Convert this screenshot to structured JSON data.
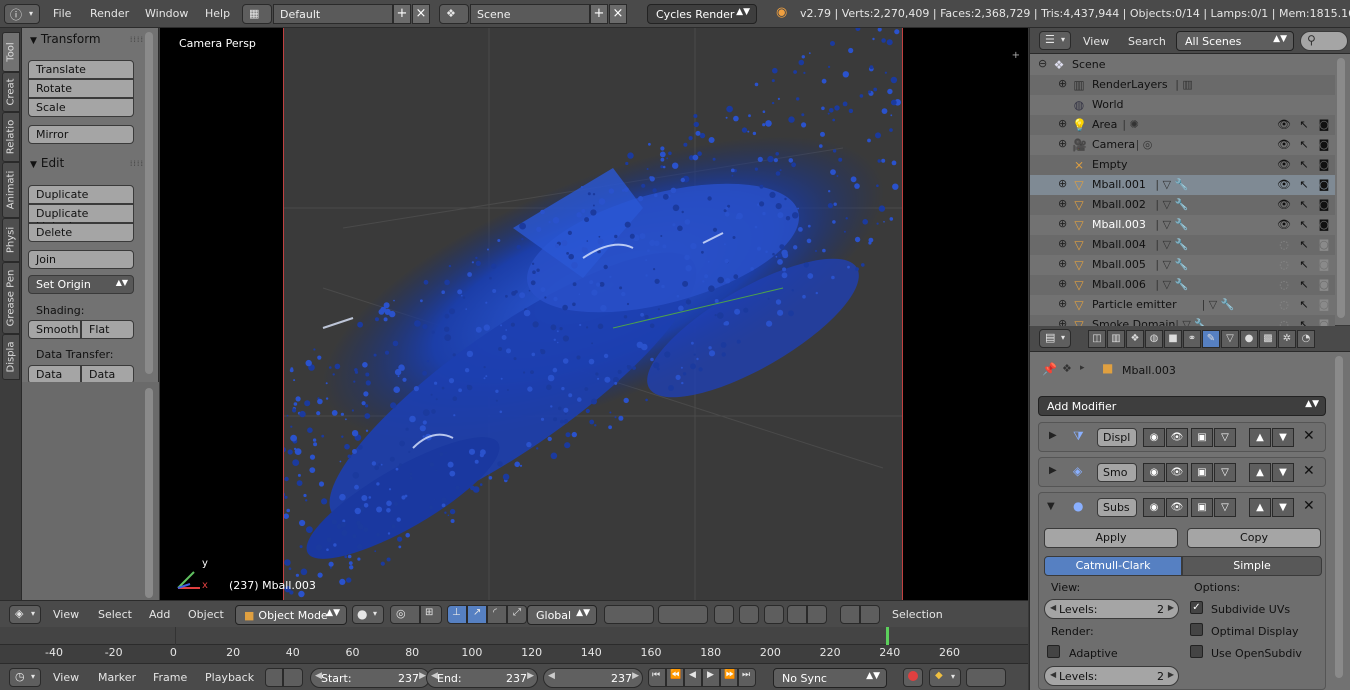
{
  "topbar": {
    "menus": [
      "File",
      "Render",
      "Window",
      "Help"
    ],
    "layout": "Default",
    "scene": "Scene",
    "engine": "Cycles Render",
    "stats": "v2.79 | Verts:2,270,409 | Faces:2,368,729 | Tris:4,437,944 | Objects:0/14 | Lamps:0/1 | Mem:1815.16M |"
  },
  "toolshelf": {
    "tabs": [
      "Tool",
      "Creat",
      "Relatio",
      "Animati",
      "Physi",
      "Grease Pen",
      "Displa"
    ],
    "transform_title": "Transform",
    "translate": "Translate",
    "rotate": "Rotate",
    "scale": "Scale",
    "mirror": "Mirror",
    "edit_title": "Edit",
    "duplicate": "Duplicate",
    "duplicate_linked": "Duplicate Linked",
    "delete": "Delete",
    "join": "Join",
    "set_origin": "Set Origin",
    "shading_label": "Shading:",
    "smooth": "Smooth",
    "flat": "Flat",
    "data_transfer_label": "Data Transfer:",
    "data": "Data",
    "data_layout": "Data La"
  },
  "viewport": {
    "view_name": "Camera Persp",
    "object_label": "(237) Mball.003",
    "axis_y": "y",
    "axis_x": "x"
  },
  "view3d_header": {
    "view": "View",
    "select": "Select",
    "add": "Add",
    "object": "Object",
    "mode": "Object Mode",
    "orientation": "Global",
    "selection": "Selection"
  },
  "timeline": {
    "ticks": [
      "-40",
      "-20",
      "0",
      "20",
      "40",
      "60",
      "80",
      "100",
      "120",
      "140",
      "160",
      "180",
      "200",
      "220",
      "240",
      "260"
    ],
    "current_frame_marker": 238,
    "view": "View",
    "marker": "Marker",
    "frame": "Frame",
    "playback": "Playback",
    "start_label": "Start:",
    "start_value": "237",
    "end_label": "End:",
    "end_value": "237",
    "current": "237",
    "sync": "No Sync"
  },
  "outliner": {
    "view": "View",
    "search": "Search",
    "filter": "All Scenes",
    "rows": [
      {
        "name": "Scene"
      },
      {
        "name": "RenderLayers"
      },
      {
        "name": "World"
      },
      {
        "name": "Area"
      },
      {
        "name": "Camera"
      },
      {
        "name": "Empty"
      },
      {
        "name": "Mball.001"
      },
      {
        "name": "Mball.002"
      },
      {
        "name": "Mball.003"
      },
      {
        "name": "Mball.004"
      },
      {
        "name": "Mball.005"
      },
      {
        "name": "Mball.006"
      },
      {
        "name": "Particle emitter"
      },
      {
        "name": "Smoke Domain"
      }
    ]
  },
  "properties": {
    "object_name": "Mball.003",
    "add_modifier": "Add Modifier",
    "modifiers": [
      {
        "name": "Displ",
        "expanded": false
      },
      {
        "name": "Smo",
        "expanded": false
      },
      {
        "name": "Subs",
        "expanded": true
      }
    ],
    "apply": "Apply",
    "copy": "Copy",
    "catmull": "Catmull-Clark",
    "simple": "Simple",
    "view_label": "View:",
    "levels_label": "Levels:",
    "view_levels": "2",
    "render_label": "Render:",
    "render_levels": "2",
    "options_label": "Options:",
    "subdivide_uvs": "Subdivide UVs",
    "optimal_display": "Optimal Display",
    "adaptive": "Adaptive",
    "use_opensubdiv": "Use OpenSubdiv"
  }
}
